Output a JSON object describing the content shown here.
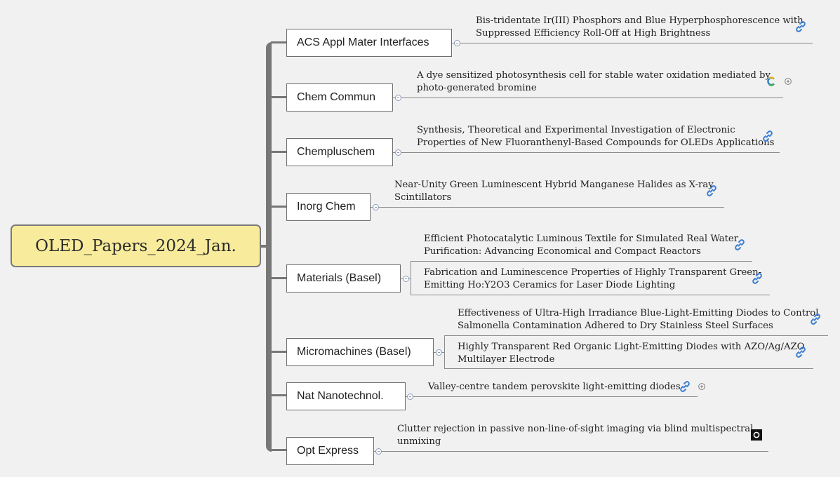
{
  "root": {
    "title": "OLED_Papers_2024_Jan."
  },
  "journals": [
    {
      "name": "ACS Appl Mater Interfaces"
    },
    {
      "name": "Chem Commun"
    },
    {
      "name": "Chempluschem"
    },
    {
      "name": "Inorg Chem"
    },
    {
      "name": "Materials (Basel)"
    },
    {
      "name": "Micromachines (Basel)"
    },
    {
      "name": "Nat Nanotechnol."
    },
    {
      "name": "Opt Express"
    }
  ],
  "papers": [
    {
      "journal": "ACS Appl Mater Interfaces",
      "line1": "Bis-tridentate Ir(III) Phosphors and Blue Hyperphosphorescence with",
      "line2": "Suppressed Efficiency Roll-Off at High Brightness",
      "icon": "link-icon"
    },
    {
      "journal": "Chem Commun",
      "line1": "A dye sensitized photosynthesis cell for stable water oxidation mediated by",
      "line2": "photo-generated bromine",
      "icon": "source-c-icon"
    },
    {
      "journal": "Chempluschem",
      "line1": "Synthesis, Theoretical and Experimental Investigation of Electronic",
      "line2": "Properties of New Fluoranthenyl-Based Compounds for OLEDs Applications",
      "icon": "link-icon"
    },
    {
      "journal": "Inorg Chem",
      "line1": "Near-Unity Green Luminescent Hybrid Manganese Halides as X-ray",
      "line2": "Scintillators",
      "icon": "link-icon"
    },
    {
      "journal": "Materials (Basel)",
      "line1": "Efficient Photocatalytic Luminous Textile for Simulated Real Water",
      "line2": "Purification: Advancing Economical and Compact Reactors",
      "icon": "link-icon"
    },
    {
      "journal": "Materials (Basel)",
      "line1": "Fabrication and Luminescence Properties of Highly Transparent Green-",
      "line2": "Emitting Ho:Y2O3 Ceramics for Laser Diode Lighting",
      "icon": "link-icon"
    },
    {
      "journal": "Micromachines (Basel)",
      "line1": "Effectiveness of Ultra-High Irradiance Blue-Light-Emitting Diodes to Control",
      "line2": "Salmonella Contamination Adhered to Dry Stainless Steel Surfaces",
      "icon": "link-icon"
    },
    {
      "journal": "Micromachines (Basel)",
      "line1": "Highly Transparent Red Organic Light-Emitting Diodes with AZO/Ag/AZO",
      "line2": "Multilayer Electrode",
      "icon": "link-icon"
    },
    {
      "journal": "Nat Nanotechnol.",
      "line1": "Valley-centre tandem perovskite light-emitting diodes",
      "line2": "",
      "icon": "link-icon"
    },
    {
      "journal": "Opt Express",
      "line1": "Clutter rejection in passive non-line-of-sight imaging via blind multispectral",
      "line2": "unmixing",
      "icon": "square-logo-icon"
    }
  ],
  "colors": {
    "root_fill": "#f8ec9c",
    "spine": "#777777",
    "link_icon": "#3d7fd1",
    "background": "#f1f1f1"
  }
}
